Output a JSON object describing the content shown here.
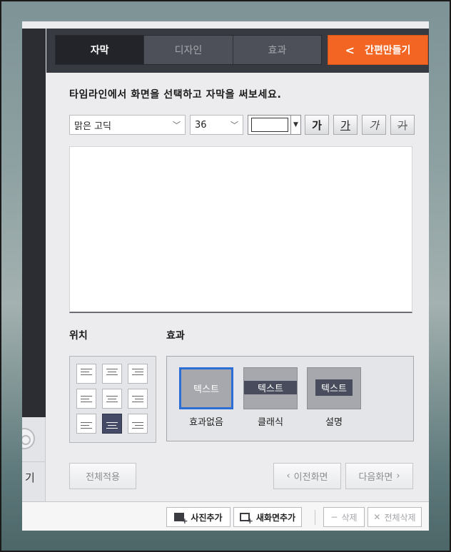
{
  "tabs": [
    {
      "label": "자막",
      "active": true
    },
    {
      "label": "디자인",
      "active": false
    },
    {
      "label": "효과",
      "active": false
    }
  ],
  "quick_make": {
    "icon": "chevron-left-icon",
    "label": "간편만들기",
    "color": "#f26522"
  },
  "left_strip": {
    "label": "기"
  },
  "instruction": "타임라인에서 화면을 선택하고 자막을 써보세요.",
  "font_select": {
    "value": "맑은 고딕"
  },
  "size_select": {
    "value": "36"
  },
  "text_color": "#ffffff",
  "style_buttons": [
    {
      "name": "bold",
      "label": "가"
    },
    {
      "name": "underline",
      "label": "가"
    },
    {
      "name": "italic",
      "label": "가"
    },
    {
      "name": "strikethrough",
      "label": "가"
    }
  ],
  "subtitle_text": {
    "value": ""
  },
  "position": {
    "label": "위치",
    "selected": "bottom-center"
  },
  "effects": {
    "label": "효과",
    "items": [
      {
        "thumb_text": "텍스트",
        "caption": "효과없음",
        "selected": true
      },
      {
        "thumb_text": "텍스트",
        "caption": "클래식",
        "selected": false
      },
      {
        "thumb_text": "텍스트",
        "caption": "설명",
        "selected": false
      }
    ]
  },
  "buttons": {
    "apply_all": "전체적용",
    "prev_screen": "이전화면",
    "next_screen": "다음화면"
  },
  "bottom_bar": {
    "add_photo": "사진추가",
    "new_screen": "새화면추가",
    "delete": "삭제",
    "delete_all": "전체삭제"
  },
  "colors": {
    "accent": "#f26522",
    "selected_border": "#2b6fd6",
    "tabbar_bg": "#383a42"
  }
}
